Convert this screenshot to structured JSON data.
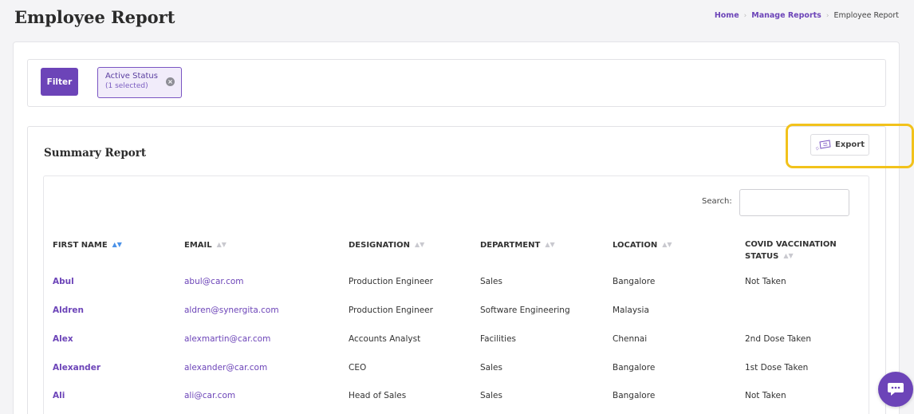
{
  "page": {
    "title": "Employee Report",
    "breadcrumb": [
      "Home",
      "Manage Reports",
      "Employee Report"
    ]
  },
  "filter": {
    "button_label": "Filter",
    "chip_label": "Active Status",
    "chip_sub": "(1 selected)"
  },
  "summary": {
    "title": "Summary Report",
    "export_label": "Export"
  },
  "search": {
    "label": "Search:",
    "value": ""
  },
  "table": {
    "columns": [
      "FIRST NAME",
      "EMAIL",
      "DESIGNATION",
      "DEPARTMENT",
      "LOCATION",
      "COVID VACCINATION",
      "STATUS"
    ],
    "rows": [
      [
        "Abul",
        "abul@car.com",
        "Production Engineer",
        "Sales",
        "Bangalore",
        "Not Taken"
      ],
      [
        "Aldren",
        "aldren@synergita.com",
        "Production Engineer",
        "Software Engineering",
        "Malaysia",
        ""
      ],
      [
        "Alex",
        "alexmartin@car.com",
        "Accounts Analyst",
        "Facilities",
        "Chennai",
        "2nd Dose Taken"
      ],
      [
        "Alexander",
        "alexander@car.com",
        "CEO",
        "Sales",
        "Bangalore",
        "1st Dose Taken"
      ],
      [
        "Ali",
        "ali@car.com",
        "Head of Sales",
        "Sales",
        "Bangalore",
        "Not Taken"
      ]
    ]
  },
  "colors": {
    "accent": "#6c44b8",
    "highlight": "#f2c21b",
    "sort_active": "#4b92e8"
  },
  "icons": {
    "export": "export-ticket-icon",
    "chat": "chat-icon",
    "chip_close": "close-icon",
    "sort": "sort-icon"
  }
}
